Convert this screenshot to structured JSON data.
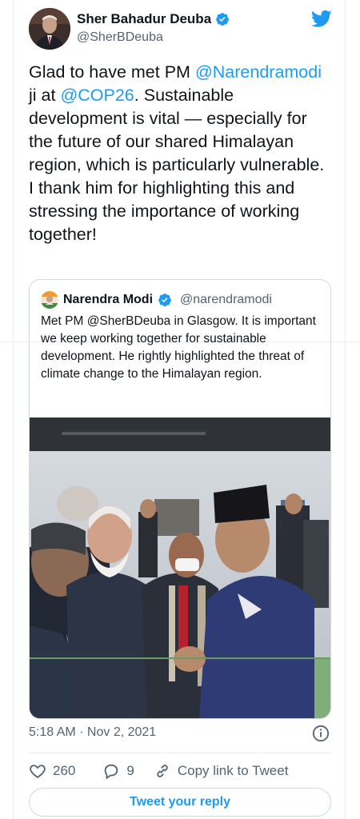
{
  "tweet": {
    "author_name": "Sher Bahadur Deuba",
    "author_handle": "@SherBDeuba",
    "text_part1": "Glad to have met PM ",
    "mention1": "@Narendramodi",
    "text_part2": " ji at ",
    "mention2": "@COP26",
    "text_part3": ". Sustainable development is vital — especially for the future of our shared Himalayan region, which is particularly vulnerable. I thank him for highlighting this and stressing the importance of working together!",
    "timestamp": "5:18 AM · Nov 2, 2021"
  },
  "quoted": {
    "author_name": "Narendra Modi",
    "author_handle": "@narendramodi",
    "text": "Met PM @SherBDeuba in Glasgow. It is important we keep working together for sustainable development. He rightly highlighted the threat of climate change to the Himalayan region."
  },
  "actions": {
    "likes": "260",
    "replies": "9",
    "copy_link": "Copy link to Tweet"
  },
  "reply_button": "Tweet your reply",
  "colors": {
    "accent": "#1d9bf0",
    "text": "#0f1419",
    "muted": "#536471",
    "border": "#cfd9de"
  },
  "icons": [
    "verified-badge-icon",
    "twitter-bird-icon",
    "info-icon",
    "heart-icon",
    "reply-icon",
    "link-icon"
  ]
}
